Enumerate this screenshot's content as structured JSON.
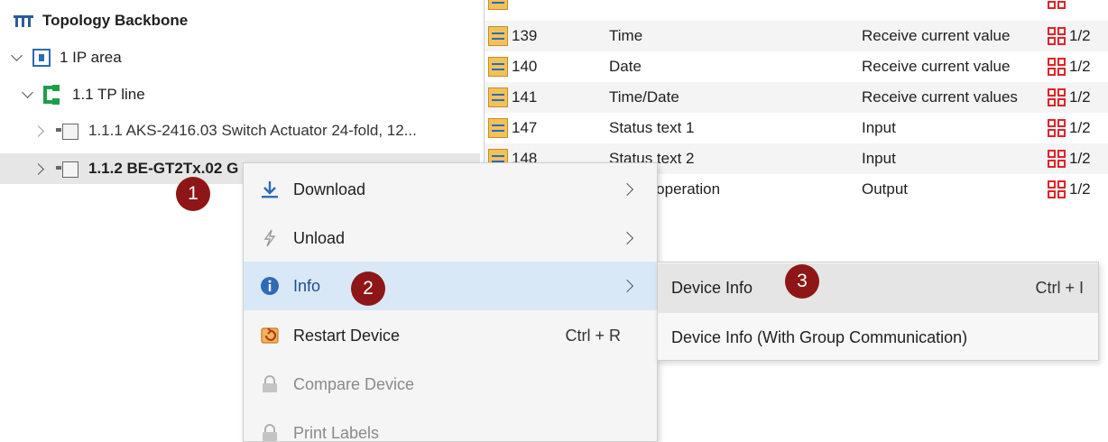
{
  "tree": {
    "root_label": "Topology Backbone",
    "area_label": "1 IP area",
    "line_label": "1.1 TP line",
    "devices": [
      {
        "label": "1.1.1 AKS-2416.03 Switch Actuator 24-fold, 12..."
      },
      {
        "label": "1.1.2 BE-GT2Tx.02 G"
      }
    ]
  },
  "grid": {
    "rows": [
      {
        "num": "139",
        "name": "Time",
        "function": "Receive current value",
        "flag": "1/2"
      },
      {
        "num": "140",
        "name": "Date",
        "function": "Receive current value",
        "flag": "1/2"
      },
      {
        "num": "141",
        "name": "Time/Date",
        "function": "Receive current values",
        "flag": "1/2"
      },
      {
        "num": "147",
        "name": "Status text 1",
        "function": "Input",
        "flag": "1/2"
      },
      {
        "num": "148",
        "name": "Status text 2",
        "function": "Input",
        "flag": "1/2"
      },
      {
        "num": "",
        "name": "n operation",
        "function": "Output",
        "flag": "1/2"
      }
    ]
  },
  "context_menu": {
    "items": [
      {
        "label": "Download",
        "shortcut": "",
        "icon": "download-icon",
        "has_submenu": true,
        "disabled": false
      },
      {
        "label": "Unload",
        "shortcut": "",
        "icon": "lightning-icon",
        "has_submenu": true,
        "disabled": false
      },
      {
        "label": "Info",
        "shortcut": "",
        "icon": "info-icon",
        "has_submenu": true,
        "disabled": false
      },
      {
        "label": "Restart Device",
        "shortcut": "Ctrl + R",
        "icon": "restart-icon",
        "has_submenu": false,
        "disabled": false
      },
      {
        "label": "Compare Device",
        "shortcut": "",
        "icon": "lock-icon",
        "has_submenu": false,
        "disabled": true
      },
      {
        "label": "Print Labels",
        "shortcut": "",
        "icon": "lock-icon",
        "has_submenu": false,
        "disabled": true
      }
    ]
  },
  "submenu": {
    "items": [
      {
        "label": "Device Info",
        "shortcut": "Ctrl + I"
      },
      {
        "label": "Device Info (With Group Communication)",
        "shortcut": ""
      }
    ]
  },
  "badges": [
    "1",
    "2",
    "3"
  ],
  "colors": {
    "highlight": "#d9e8f7",
    "badge": "#8f1616",
    "flag_red": "#e0242a",
    "line_green": "#1e9e4a",
    "area_blue": "#2a6ab5"
  }
}
